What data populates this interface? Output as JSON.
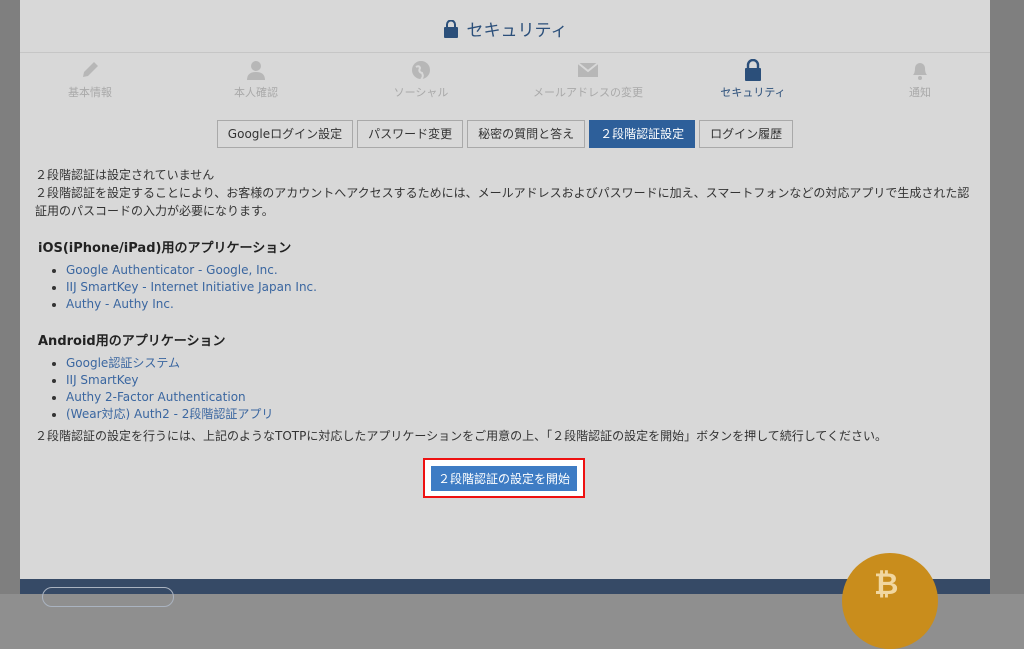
{
  "header": {
    "title": "セキュリティ"
  },
  "nav": [
    {
      "label": "基本情報",
      "icon": "pencil-icon"
    },
    {
      "label": "本人確認",
      "icon": "person-icon"
    },
    {
      "label": "ソーシャル",
      "icon": "globe-icon"
    },
    {
      "label": "メールアドレスの変更",
      "icon": "envelope-icon"
    },
    {
      "label": "セキュリティ",
      "icon": "lock-icon",
      "active": true
    },
    {
      "label": "通知",
      "icon": "bell-icon"
    }
  ],
  "tabs": [
    {
      "label": "Googleログイン設定"
    },
    {
      "label": "パスワード変更"
    },
    {
      "label": "秘密の質問と答え"
    },
    {
      "label": "２段階認証設定",
      "active": true
    },
    {
      "label": "ログイン履歴"
    }
  ],
  "content": {
    "status": "２段階認証は設定されていません",
    "description": "２段階認証を設定することにより、お客様のアカウントへアクセスするためには、メールアドレスおよびパスワードに加え、スマートフォンなどの対応アプリで生成された認証用のパスコードの入力が必要になります。",
    "ios_heading": "iOS(iPhone/iPad)用のアプリケーション",
    "ios_apps": [
      "Google Authenticator - Google, Inc.",
      "IIJ SmartKey - Internet Initiative Japan Inc.",
      "Authy - Authy Inc."
    ],
    "android_heading": "Android用のアプリケーション",
    "android_apps": [
      "Google認証システム",
      "IIJ SmartKey",
      "Authy 2-Factor Authentication",
      "(Wear対応) Auth2 - 2段階認証アプリ"
    ],
    "instruction": "２段階認証の設定を行うには、上記のようなTOTPに対応したアプリケーションをご用意の上、「２段階認証の設定を開始」ボタンを押して続行してください。",
    "start_button": "２段階認証の設定を開始"
  },
  "colors": {
    "accent": "#2d5f9a",
    "button": "#3e7cc4",
    "highlight": "#ee1111",
    "footer": "#364a66",
    "coin": "#c98d1c"
  }
}
